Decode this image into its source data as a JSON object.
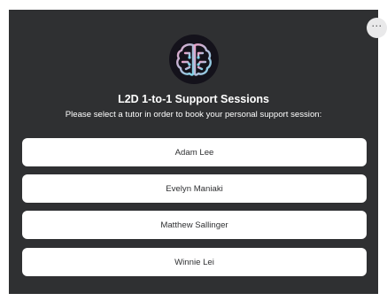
{
  "menu": {
    "icon": "more-horizontal-icon",
    "label": "···"
  },
  "logo": {
    "icon": "brain-circuit-icon"
  },
  "header": {
    "title": "L2D 1-to-1 Support Sessions",
    "subtitle": "Please select a tutor in order to book your personal support session:"
  },
  "tutors": [
    {
      "label": "Adam Lee"
    },
    {
      "label": "Evelyn Maniaki"
    },
    {
      "label": "Matthew Sallinger"
    },
    {
      "label": "Winnie Lei"
    }
  ],
  "colors": {
    "panel_bg": "#2f3032",
    "button_bg": "#ffffff",
    "logo_gradient_start": "#e8a3c9",
    "logo_gradient_end": "#7fd3e8"
  }
}
